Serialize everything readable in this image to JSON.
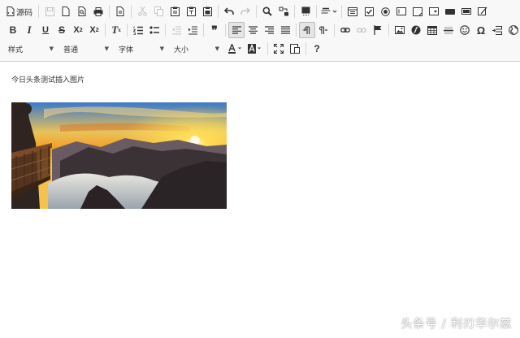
{
  "toolbar": {
    "source_label": "源码",
    "combos": {
      "style": "样式",
      "format": "普通",
      "font": "字体",
      "size": "大小"
    },
    "special_char_glyph": "Ω",
    "help_glyph": "?",
    "quote_glyph": "❞"
  },
  "editor": {
    "paragraph_text": "今日头条测试插入图片",
    "image_alt": "sunset over mountains with cloud sea"
  },
  "watermark": "头条号 / 利刃华尔兹",
  "colors": {
    "toolbar_bg": "#f8f8f8",
    "border": "#d1d1d1",
    "icon": "#333333",
    "disabled": "#c4c4c4"
  }
}
